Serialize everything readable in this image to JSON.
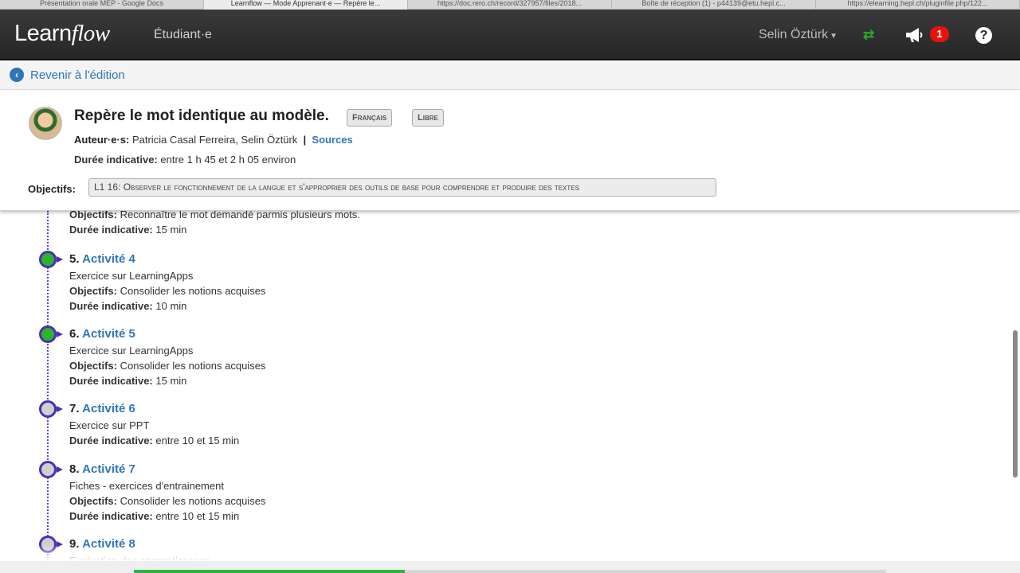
{
  "browser_tabs": [
    "Présentation orale MEP - Google Docs",
    "Learnflow — Mode Apprenant·e — Repère le...",
    "https://doc.rero.ch/record/327957/files/2018...",
    "Boîte de réception (1) - p44139@etu.hepl.c...",
    "https://elearning.hepl.ch/pluginfile.php/122..."
  ],
  "navbar": {
    "logo_learn": "Learn",
    "logo_flow": "flow",
    "role": "Étudiant·e",
    "user": "Selin Öztürk",
    "notification_count": "1",
    "help": "?"
  },
  "subbar": {
    "back_label": "Revenir à l'édition"
  },
  "header": {
    "title": "Repère le mot identique au modèle.",
    "tag_subject": "Français",
    "tag_license": "Libre",
    "authors_label": "Auteur·e·s:",
    "authors": "Patricia Casal Ferreira, Selin Öztürk",
    "separator": "|",
    "sources": "Sources",
    "duration_label": "Durée indicative:",
    "duration": "entre 1 h 45 et 2 h 05 environ",
    "objectives_label": "Objectifs:",
    "objective": "L1 16: Observer le fonctionnement de la langue et s'approprier des outils de base pour comprendre et produire des textes"
  },
  "previous_activity": {
    "objectives_label": "Objectifs:",
    "objectives": "Reconnaître le mot demandé parmis plusieurs mots.",
    "duration_label": "Durée indicative:",
    "duration": "15 min"
  },
  "activities": [
    {
      "number": "5.",
      "title": "Activité 4",
      "type": "Exercice sur LearningApps",
      "objectives_label": "Objectifs:",
      "objectives": "Consolider les notions acquises",
      "duration_label": "Durée indicative:",
      "duration": "10 min",
      "status": "done"
    },
    {
      "number": "6.",
      "title": "Activité 5",
      "type": "Exercice sur LearningApps",
      "objectives_label": "Objectifs:",
      "objectives": "Consolider les notions acquises",
      "duration_label": "Durée indicative:",
      "duration": "15 min",
      "status": "done"
    },
    {
      "number": "7.",
      "title": "Activité 6",
      "type": "Exercice sur PPT",
      "duration_label": "Durée indicative:",
      "duration": "entre 10 et 15 min",
      "status": "todo"
    },
    {
      "number": "8.",
      "title": "Activité 7",
      "type": "Fiches - exercices d'entrainement",
      "objectives_label": "Objectifs:",
      "objectives": "Consolider les notions acquises",
      "duration_label": "Durée indicative:",
      "duration": "entre 10 et 15 min",
      "status": "todo"
    },
    {
      "number": "9.",
      "title": "Activité 8",
      "type": "Evaluation des apprentissages",
      "status": "todo"
    }
  ],
  "progress_fraction": 0.36,
  "colors": {
    "navbar": "#2f2f2f",
    "link": "#2e75b8",
    "done": "#2bb52b",
    "timeline": "#4b2fb8",
    "badge": "#e8120c"
  }
}
